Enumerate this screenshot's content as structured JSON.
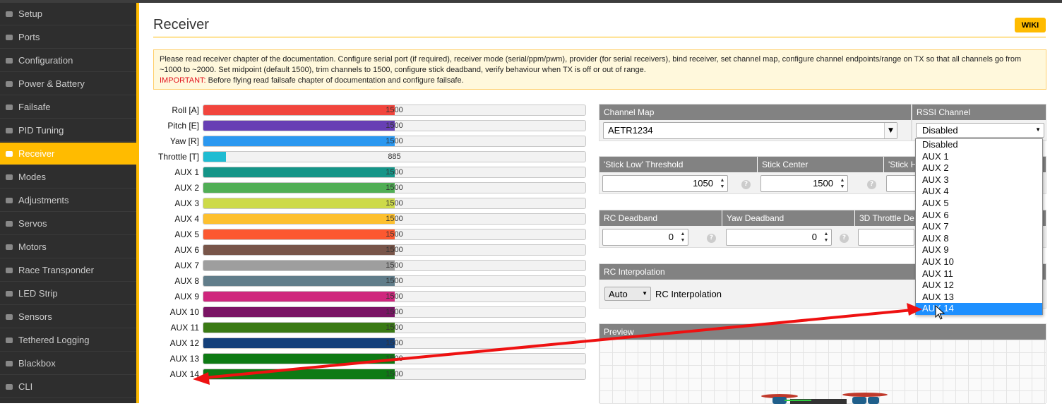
{
  "sidebar": {
    "items": [
      {
        "label": "Setup",
        "icon": "wrench-icon"
      },
      {
        "label": "Ports",
        "icon": "plug-icon"
      },
      {
        "label": "Configuration",
        "icon": "gear-icon"
      },
      {
        "label": "Power & Battery",
        "icon": "battery-icon"
      },
      {
        "label": "Failsafe",
        "icon": "parachute-icon"
      },
      {
        "label": "PID Tuning",
        "icon": "tree-icon"
      },
      {
        "label": "Receiver",
        "icon": "receiver-icon"
      },
      {
        "label": "Modes",
        "icon": "modes-icon"
      },
      {
        "label": "Adjustments",
        "icon": "sliders-icon"
      },
      {
        "label": "Servos",
        "icon": "servo-icon"
      },
      {
        "label": "Motors",
        "icon": "motor-icon"
      },
      {
        "label": "Race Transponder",
        "icon": "transponder-icon"
      },
      {
        "label": "LED Strip",
        "icon": "led-icon"
      },
      {
        "label": "Sensors",
        "icon": "sensor-icon"
      },
      {
        "label": "Tethered Logging",
        "icon": "keyboard-icon"
      },
      {
        "label": "Blackbox",
        "icon": "chip-icon"
      },
      {
        "label": "CLI",
        "icon": "terminal-icon"
      }
    ],
    "active_index": 6
  },
  "page": {
    "title": "Receiver",
    "wiki_label": "WIKI",
    "note_line1": "Please read receiver chapter of the documentation. Configure serial port (if required), receiver mode (serial/ppm/pwm), provider (for serial receivers), bind receiver, set channel map, configure channel endpoints/range on TX so that all channels go from ~1000 to ~2000. Set midpoint (default 1500), trim channels to 1500, configure stick deadband, verify behaviour when TX is off or out of range.",
    "note_important": "IMPORTANT:",
    "note_line2": " Before flying read failsafe chapter of documentation and configure failsafe."
  },
  "channels": [
    {
      "label": "Roll [A]",
      "value": "1500",
      "fraction": 0.5,
      "color": "#f1453d"
    },
    {
      "label": "Pitch [E]",
      "value": "1500",
      "fraction": 0.5,
      "color": "#673fb4"
    },
    {
      "label": "Yaw [R]",
      "value": "1500",
      "fraction": 0.5,
      "color": "#2b98f0"
    },
    {
      "label": "Throttle [T]",
      "value": "885",
      "fraction": 0.06,
      "color": "#1fbcd2"
    },
    {
      "label": "AUX 1",
      "value": "1500",
      "fraction": 0.5,
      "color": "#159588"
    },
    {
      "label": "AUX 2",
      "value": "1500",
      "fraction": 0.5,
      "color": "#50ae55"
    },
    {
      "label": "AUX 3",
      "value": "1500",
      "fraction": 0.5,
      "color": "#cdda49"
    },
    {
      "label": "AUX 4",
      "value": "1500",
      "fraction": 0.5,
      "color": "#fdc02f"
    },
    {
      "label": "AUX 5",
      "value": "1500",
      "fraction": 0.5,
      "color": "#fc5830"
    },
    {
      "label": "AUX 6",
      "value": "1500",
      "fraction": 0.5,
      "color": "#785549"
    },
    {
      "label": "AUX 7",
      "value": "1500",
      "fraction": 0.5,
      "color": "#9e9e9e"
    },
    {
      "label": "AUX 8",
      "value": "1500",
      "fraction": 0.5,
      "color": "#617d8a"
    },
    {
      "label": "AUX 9",
      "value": "1500",
      "fraction": 0.5,
      "color": "#cf267d"
    },
    {
      "label": "AUX 10",
      "value": "1500",
      "fraction": 0.5,
      "color": "#7a1464"
    },
    {
      "label": "AUX 11",
      "value": "1500",
      "fraction": 0.5,
      "color": "#3a7a14"
    },
    {
      "label": "AUX 12",
      "value": "1500",
      "fraction": 0.5,
      "color": "#14407a"
    },
    {
      "label": "AUX 13",
      "value": "1500",
      "fraction": 0.5,
      "color": "#0e7a14"
    },
    {
      "label": "AUX 14",
      "value": "1500",
      "fraction": 0.5,
      "color": "#0e7a14"
    }
  ],
  "channel_map": {
    "header": "Channel Map",
    "value": "AETR1234"
  },
  "rssi": {
    "header": "RSSI Channel",
    "value": "Disabled",
    "options": [
      "Disabled",
      "AUX 1",
      "AUX 2",
      "AUX 3",
      "AUX 4",
      "AUX 5",
      "AUX 6",
      "AUX 7",
      "AUX 8",
      "AUX 9",
      "AUX 10",
      "AUX 11",
      "AUX 12",
      "AUX 13",
      "AUX 14"
    ],
    "highlighted": "AUX 14"
  },
  "stick": {
    "low_header": "'Stick Low' Threshold",
    "low_value": "1050",
    "center_header": "Stick Center",
    "center_value": "1500",
    "high_header": "'Stick H"
  },
  "deadband": {
    "rc_header": "RC Deadband",
    "rc_value": "0",
    "yaw_header": "Yaw Deadband",
    "yaw_value": "0",
    "throttle_header": "3D Throttle De"
  },
  "interpolation": {
    "header": "RC Interpolation",
    "select_value": "Auto",
    "label": "RC Interpolation"
  },
  "preview": {
    "header": "Preview"
  },
  "help_glyph": "?",
  "colors": {
    "accent": "#ffbb00",
    "annotation_arrow": "#ee1111",
    "selection": "#1e90ff"
  }
}
